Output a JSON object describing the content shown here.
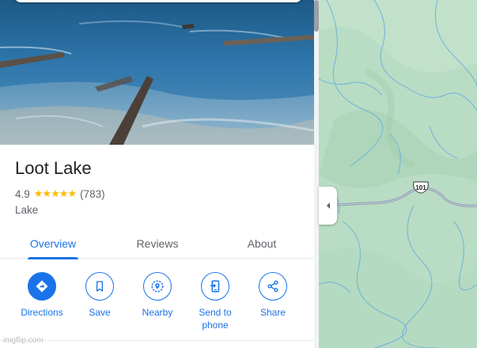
{
  "place": {
    "name": "Loot Lake",
    "rating": "4.9",
    "stars": "★★★★★",
    "review_count": "(783)",
    "category": "Lake"
  },
  "tabs": [
    {
      "label": "Overview",
      "active": true
    },
    {
      "label": "Reviews",
      "active": false
    },
    {
      "label": "About",
      "active": false
    }
  ],
  "actions": {
    "directions": {
      "label": "Directions",
      "icon": "directions-icon"
    },
    "save": {
      "label": "Save",
      "icon": "bookmark-icon"
    },
    "nearby": {
      "label": "Nearby",
      "icon": "nearby-icon"
    },
    "send_to_phone": {
      "label": "Send to phone",
      "icon": "send-to-phone-icon"
    },
    "share": {
      "label": "Share",
      "icon": "share-icon"
    }
  },
  "map": {
    "highway_shield": "101"
  },
  "watermark": "imgflip.com",
  "colors": {
    "accent": "#1a73e8",
    "star": "#fbbc04",
    "map_terrain": "#b9dcc4",
    "map_water": "#6fb3d9",
    "road": "#8a9aae"
  }
}
